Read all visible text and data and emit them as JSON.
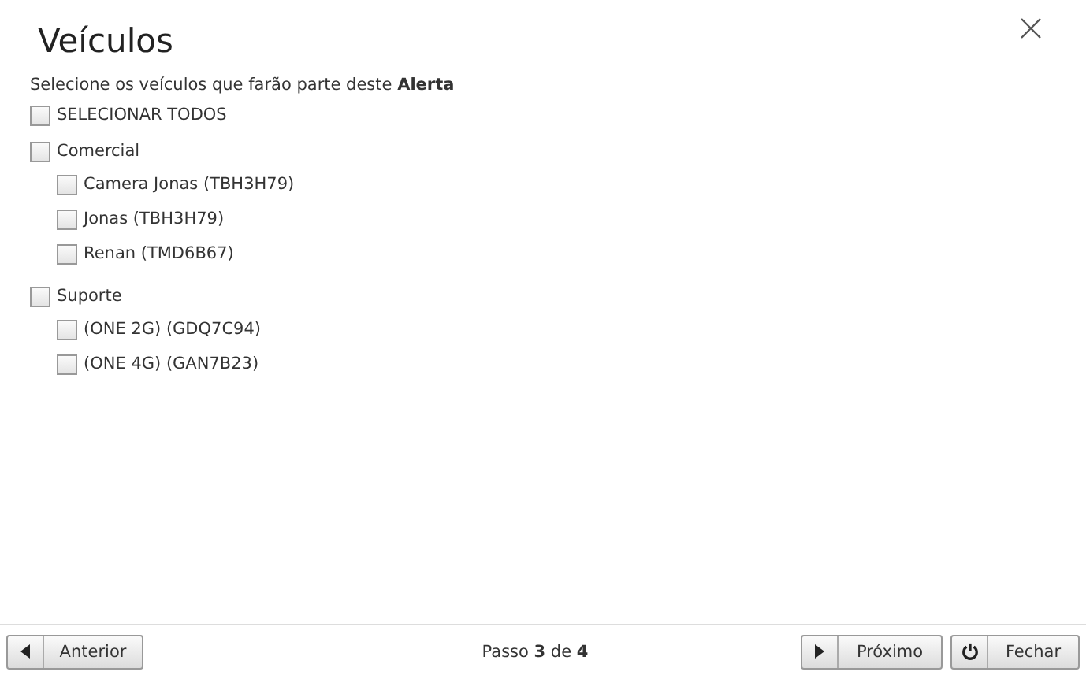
{
  "dialog": {
    "title": "Veículos",
    "instruction": "Selecione os veículos que farão parte deste **Alerta**"
  },
  "select_all": {
    "label": "SELECIONAR TODOS",
    "checked": false
  },
  "groups": [
    {
      "label": "Comercial",
      "checked": false,
      "children": [
        {
          "label": "Camera Jonas (TBH3H79)",
          "checked": false
        },
        {
          "label": "Jonas (TBH3H79)",
          "checked": false
        },
        {
          "label": "Renan (TMD6B67)",
          "checked": false
        }
      ]
    },
    {
      "label": "Suporte",
      "checked": false,
      "children": [
        {
          "label": "(ONE 2G) (GDQ7C94)",
          "checked": false
        },
        {
          "label": "(ONE 4G) (GAN7B23)",
          "checked": false
        }
      ]
    }
  ],
  "footer": {
    "step": "Passo **3** de **4**",
    "buttons": [
      {
        "label": "Anterior",
        "kind": "previous"
      },
      {
        "label": "Próximo",
        "kind": "next"
      },
      {
        "label": "Fechar",
        "kind": "close"
      }
    ]
  }
}
